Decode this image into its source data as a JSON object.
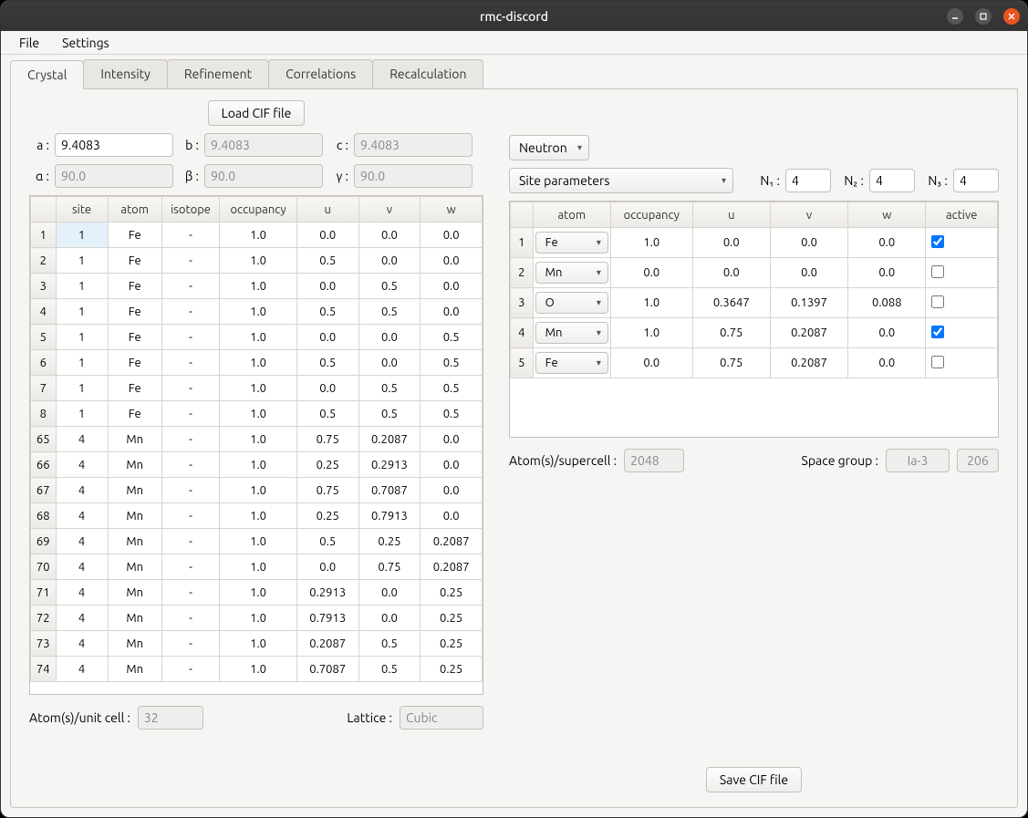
{
  "window": {
    "title": "rmc-discord"
  },
  "menu": {
    "file": "File",
    "settings": "Settings"
  },
  "tabs": [
    "Crystal",
    "Intensity",
    "Refinement",
    "Correlations",
    "Recalculation"
  ],
  "buttons": {
    "load_cif": "Load CIF file",
    "save_cif": "Save CIF file"
  },
  "lattice_params": {
    "a_label": "a :",
    "a": "9.4083",
    "b_label": "b :",
    "b": "9.4083",
    "c_label": "c :",
    "c": "9.4083",
    "alpha_label": "α :",
    "alpha": "90.0",
    "beta_label": "β :",
    "beta": "90.0",
    "gamma_label": "γ :",
    "gamma": "90.0"
  },
  "radiation": "Neutron",
  "param_mode": "Site parameters",
  "supercell": {
    "n1_label": "N₁ :",
    "n1": "4",
    "n2_label": "N₂ :",
    "n2": "4",
    "n3_label": "N₃ :",
    "n3": "4"
  },
  "left_table": {
    "headers": [
      "",
      "site",
      "atom",
      "isotope",
      "occupancy",
      "u",
      "v",
      "w"
    ],
    "rows": [
      {
        "n": "1",
        "site": "1",
        "atom": "Fe",
        "iso": "-",
        "occ": "1.0",
        "u": "0.0",
        "v": "0.0",
        "w": "0.0",
        "sel": true
      },
      {
        "n": "2",
        "site": "1",
        "atom": "Fe",
        "iso": "-",
        "occ": "1.0",
        "u": "0.5",
        "v": "0.0",
        "w": "0.0"
      },
      {
        "n": "3",
        "site": "1",
        "atom": "Fe",
        "iso": "-",
        "occ": "1.0",
        "u": "0.0",
        "v": "0.5",
        "w": "0.0"
      },
      {
        "n": "4",
        "site": "1",
        "atom": "Fe",
        "iso": "-",
        "occ": "1.0",
        "u": "0.5",
        "v": "0.5",
        "w": "0.0"
      },
      {
        "n": "5",
        "site": "1",
        "atom": "Fe",
        "iso": "-",
        "occ": "1.0",
        "u": "0.0",
        "v": "0.0",
        "w": "0.5"
      },
      {
        "n": "6",
        "site": "1",
        "atom": "Fe",
        "iso": "-",
        "occ": "1.0",
        "u": "0.5",
        "v": "0.0",
        "w": "0.5"
      },
      {
        "n": "7",
        "site": "1",
        "atom": "Fe",
        "iso": "-",
        "occ": "1.0",
        "u": "0.0",
        "v": "0.5",
        "w": "0.5"
      },
      {
        "n": "8",
        "site": "1",
        "atom": "Fe",
        "iso": "-",
        "occ": "1.0",
        "u": "0.5",
        "v": "0.5",
        "w": "0.5"
      },
      {
        "n": "65",
        "site": "4",
        "atom": "Mn",
        "iso": "-",
        "occ": "1.0",
        "u": "0.75",
        "v": "0.2087",
        "w": "0.0"
      },
      {
        "n": "66",
        "site": "4",
        "atom": "Mn",
        "iso": "-",
        "occ": "1.0",
        "u": "0.25",
        "v": "0.2913",
        "w": "0.0"
      },
      {
        "n": "67",
        "site": "4",
        "atom": "Mn",
        "iso": "-",
        "occ": "1.0",
        "u": "0.75",
        "v": "0.7087",
        "w": "0.0"
      },
      {
        "n": "68",
        "site": "4",
        "atom": "Mn",
        "iso": "-",
        "occ": "1.0",
        "u": "0.25",
        "v": "0.7913",
        "w": "0.0"
      },
      {
        "n": "69",
        "site": "4",
        "atom": "Mn",
        "iso": "-",
        "occ": "1.0",
        "u": "0.5",
        "v": "0.25",
        "w": "0.2087"
      },
      {
        "n": "70",
        "site": "4",
        "atom": "Mn",
        "iso": "-",
        "occ": "1.0",
        "u": "0.0",
        "v": "0.75",
        "w": "0.2087"
      },
      {
        "n": "71",
        "site": "4",
        "atom": "Mn",
        "iso": "-",
        "occ": "1.0",
        "u": "0.2913",
        "v": "0.0",
        "w": "0.25"
      },
      {
        "n": "72",
        "site": "4",
        "atom": "Mn",
        "iso": "-",
        "occ": "1.0",
        "u": "0.7913",
        "v": "0.0",
        "w": "0.25"
      },
      {
        "n": "73",
        "site": "4",
        "atom": "Mn",
        "iso": "-",
        "occ": "1.0",
        "u": "0.2087",
        "v": "0.5",
        "w": "0.25"
      },
      {
        "n": "74",
        "site": "4",
        "atom": "Mn",
        "iso": "-",
        "occ": "1.0",
        "u": "0.7087",
        "v": "0.5",
        "w": "0.25"
      }
    ]
  },
  "right_table": {
    "headers": [
      "",
      "atom",
      "occupancy",
      "u",
      "v",
      "w",
      "active"
    ],
    "rows": [
      {
        "n": "1",
        "atom": "Fe",
        "occ": "1.0",
        "u": "0.0",
        "v": "0.0",
        "w": "0.0",
        "active": true
      },
      {
        "n": "2",
        "atom": "Mn",
        "occ": "0.0",
        "u": "0.0",
        "v": "0.0",
        "w": "0.0",
        "active": false
      },
      {
        "n": "3",
        "atom": "O",
        "occ": "1.0",
        "u": "0.3647",
        "v": "0.1397",
        "w": "0.088",
        "active": false
      },
      {
        "n": "4",
        "atom": "Mn",
        "occ": "1.0",
        "u": "0.75",
        "v": "0.2087",
        "w": "0.0",
        "active": true
      },
      {
        "n": "5",
        "atom": "Fe",
        "occ": "0.0",
        "u": "0.75",
        "v": "0.2087",
        "w": "0.0",
        "active": false
      }
    ]
  },
  "footer": {
    "atoms_unit_label": "Atom(s)/unit cell :",
    "atoms_unit": "32",
    "lattice_label": "Lattice :",
    "lattice": "Cubic",
    "atoms_super_label": "Atom(s)/supercell :",
    "atoms_super": "2048",
    "sg_label": "Space group :",
    "sg_name": "Ia-3",
    "sg_num": "206"
  }
}
